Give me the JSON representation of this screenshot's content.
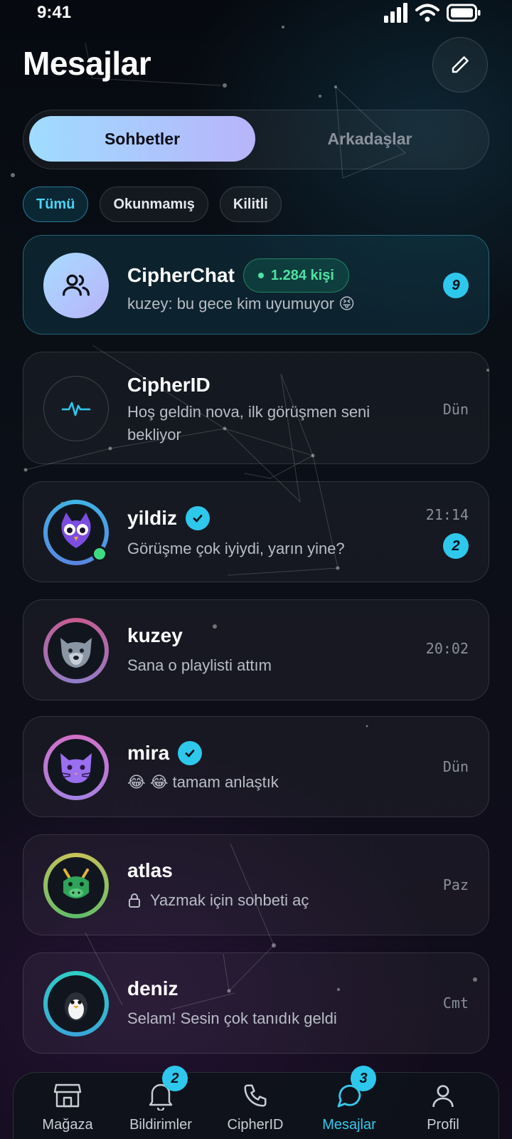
{
  "status_bar": {
    "time": "9:41"
  },
  "header": {
    "title": "Mesajlar"
  },
  "segmented": {
    "tabs": [
      "Sohbetler",
      "Arkadaşlar"
    ],
    "active": "Sohbetler"
  },
  "filters": {
    "chips": [
      "Tümü",
      "Okunmamış",
      "Kilitli"
    ],
    "active": "Tümü"
  },
  "chats": [
    {
      "name": "CipherChat",
      "members": "1.284 kişi",
      "message": "kuzey: bu gece kim uyumuyor 😝",
      "badge": "9",
      "icon": "group-icon"
    },
    {
      "name": "CipherID",
      "message_line1": "Hoş geldin nova, ilk görüşmen seni",
      "message_line2": "bekliyor",
      "time": "Dün",
      "icon": "pulse-icon"
    },
    {
      "name": "yildiz",
      "verified": true,
      "message": "Görüşme çok iyiydi, yarın yine?",
      "time": "21:14",
      "badge": "2",
      "online": true,
      "icon": "owl-avatar"
    },
    {
      "name": "kuzey",
      "message": "Sana o playlisti attım",
      "time": "20:02",
      "icon": "wolf-avatar"
    },
    {
      "name": "mira",
      "verified": true,
      "message": "😂 😂 tamam anlaştık",
      "time": "Dün",
      "icon": "cat-avatar"
    },
    {
      "name": "atlas",
      "message": "Yazmak için sohbeti aç",
      "locked": true,
      "time": "Paz",
      "icon": "dragon-avatar"
    },
    {
      "name": "deniz",
      "message": "Selam! Sesin çok tanıdık geldi",
      "time": "Cmt",
      "icon": "penguin-avatar"
    }
  ],
  "tabbar": {
    "items": [
      {
        "label": "Mağaza",
        "icon": "store-icon"
      },
      {
        "label": "Bildirimler",
        "icon": "bell-icon",
        "badge": "2"
      },
      {
        "label": "CipherID",
        "icon": "phone-icon"
      },
      {
        "label": "Mesajlar",
        "icon": "chat-icon",
        "badge": "3",
        "active": true
      },
      {
        "label": "Profil",
        "icon": "profile-icon"
      }
    ]
  },
  "colors": {
    "accent": "#2ec8ec",
    "online": "#4ee3a2",
    "background": "#0b0f17"
  }
}
